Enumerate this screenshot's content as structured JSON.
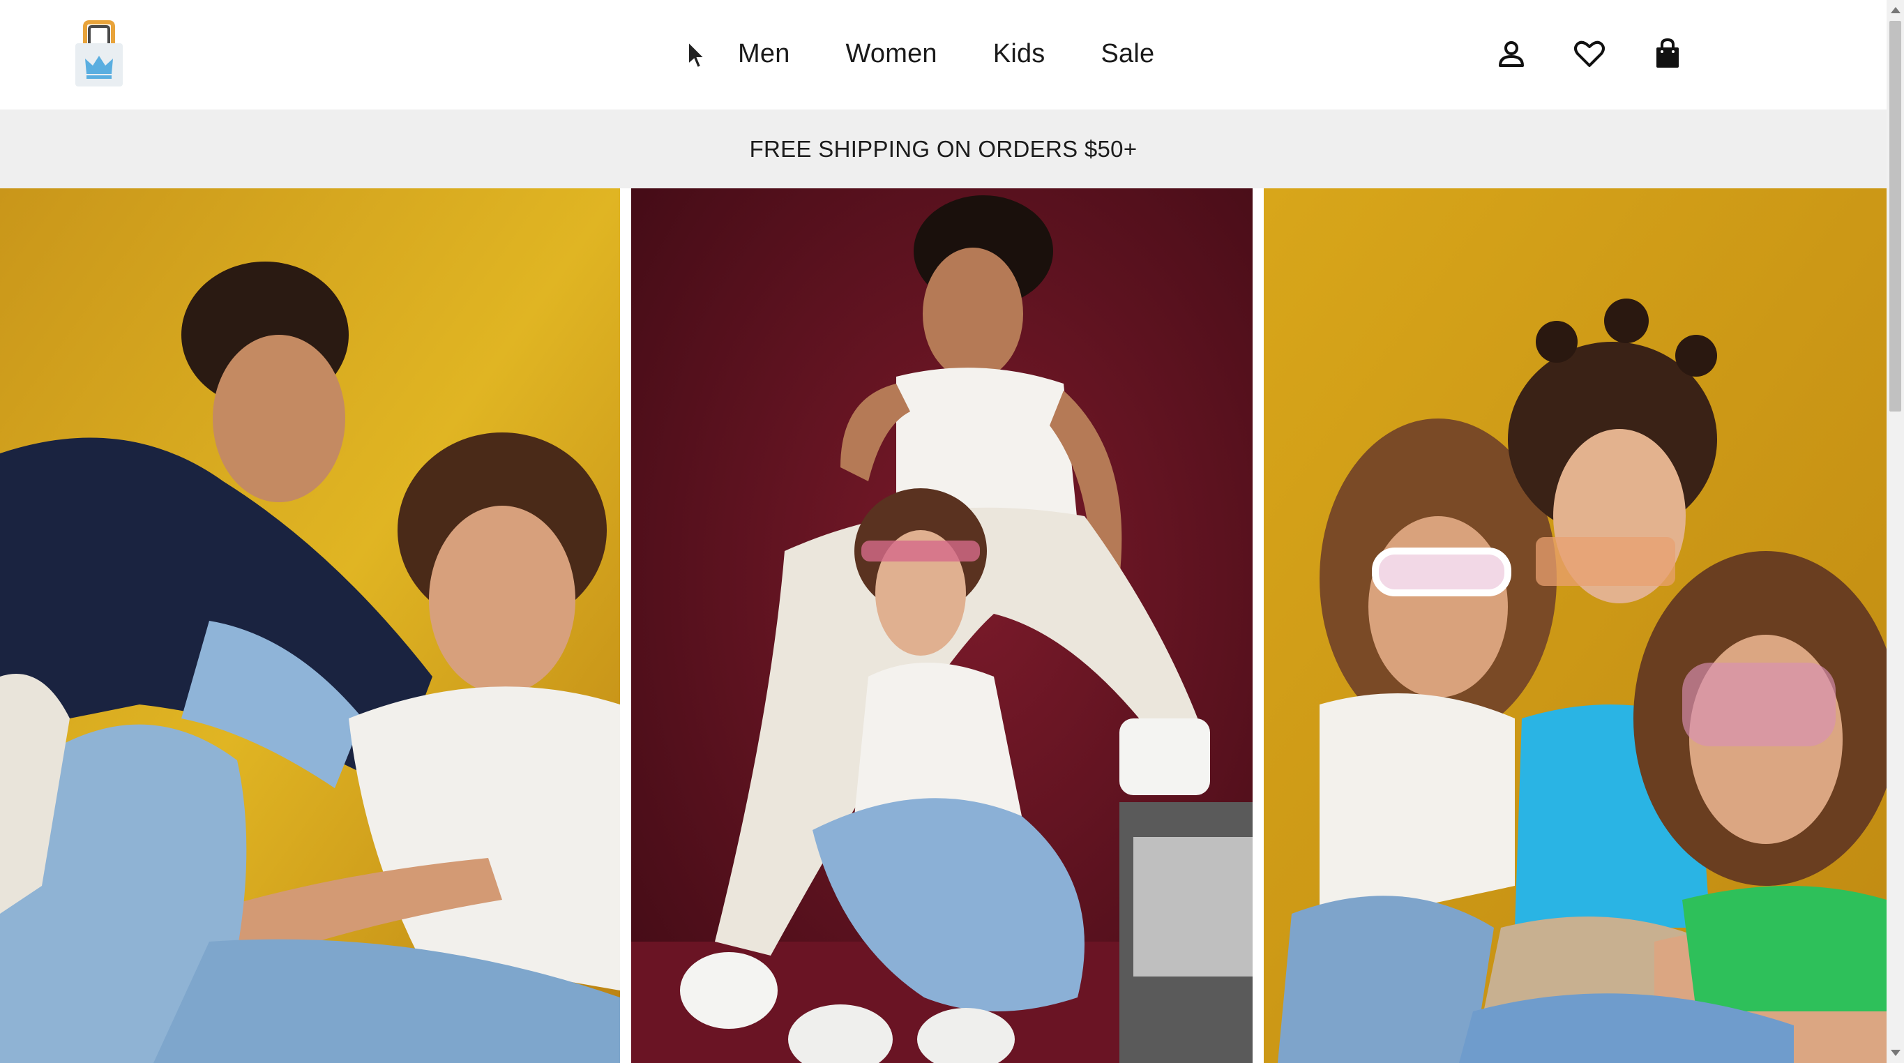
{
  "header": {
    "logo_name": "crown-shopping-bag-logo",
    "nav": [
      {
        "label": "Men"
      },
      {
        "label": "Women"
      },
      {
        "label": "Kids"
      },
      {
        "label": "Sale"
      }
    ],
    "icons": [
      "account-icon",
      "wishlist-heart-icon",
      "shopping-bag-icon"
    ]
  },
  "promo": {
    "text": "FREE SHIPPING ON ORDERS $50+"
  },
  "hero_photos": [
    {
      "name": "hero-photo-couple-yellow",
      "background": "#d8a81c"
    },
    {
      "name": "hero-photo-duo-burgundy",
      "background": "#6b1424"
    },
    {
      "name": "hero-photo-trio-yellow",
      "background": "#d9aa1b"
    }
  ],
  "colors": {
    "promo_bg": "#efefef",
    "text": "#1a1a1a",
    "logo_blue": "#5aaee0",
    "logo_orange": "#e8a33a"
  }
}
